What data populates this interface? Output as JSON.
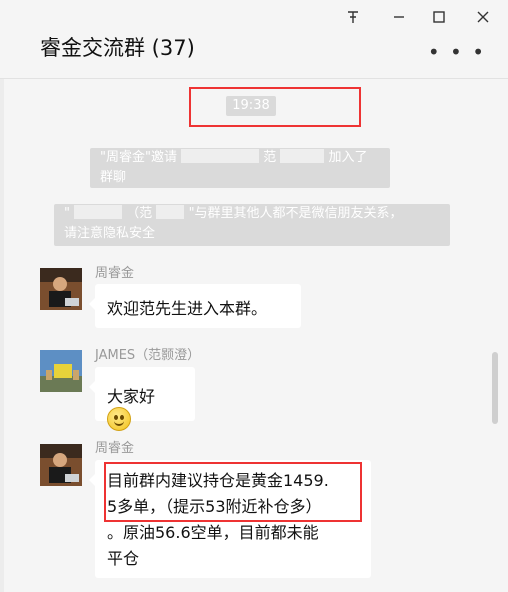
{
  "window": {
    "title": "睿金交流群 (37)",
    "controls": [
      "pin-icon",
      "minimize-icon",
      "maximize-icon",
      "close-icon"
    ],
    "more_icon": "more-icon"
  },
  "chat": {
    "time": "19:38",
    "system_messages": [
      {
        "text_prefix": "\"周睿金\"邀请",
        "text_mid": "范",
        "text_suffix": "加入了群聊"
      },
      {
        "line1_prefix": "\"",
        "line1_mid": "（范",
        "line1_suffix": "\"与群里其他人都不是微信朋友关系，",
        "line2": "请注意隐私安全"
      }
    ],
    "messages": [
      {
        "sender": "周睿金",
        "text": "欢迎范先生进入本群。"
      },
      {
        "sender": "JAMES（范颢澄）",
        "text": "大家好"
      },
      {
        "sender": "周睿金",
        "lines": [
          "目前群内建议持仓是黄金1459.",
          "5多单，（提示53附近补仓多）",
          "。原油56.6空单，目前都未能",
          "平仓"
        ]
      }
    ]
  },
  "colors": {
    "background": "#f5f5f5",
    "system_bubble": "#dadada",
    "highlight": "#ee3333",
    "bubble": "#ffffff"
  }
}
